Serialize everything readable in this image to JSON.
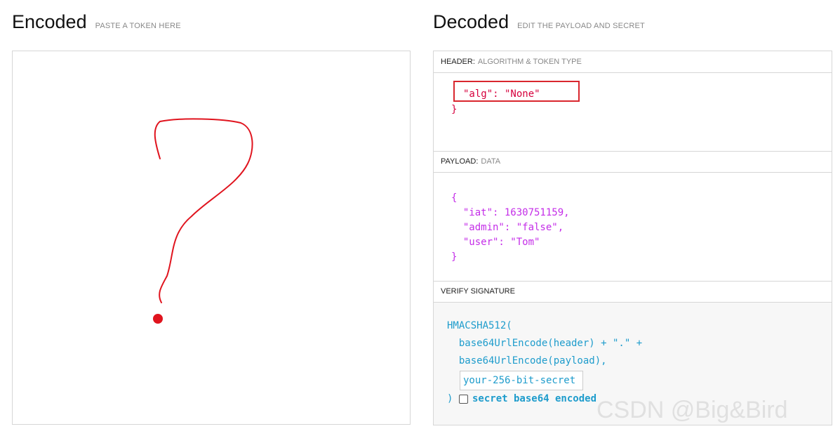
{
  "encoded": {
    "title": "Encoded",
    "subtitle": "PASTE A TOKEN HERE",
    "drawing": "hand-drawn-question-mark"
  },
  "decoded": {
    "title": "Decoded",
    "subtitle": "EDIT THE PAYLOAD AND SECRET",
    "header": {
      "label": "HEADER:",
      "sublabel": "ALGORITHM & TOKEN TYPE",
      "lines": [
        "\"alg\": \"None\"",
        "}"
      ]
    },
    "payload": {
      "label": "PAYLOAD:",
      "sublabel": "DATA",
      "lines": [
        "{",
        "  \"iat\": 1630751159,",
        "  \"admin\": \"false\",",
        "  \"user\": \"Tom\"",
        "}"
      ]
    },
    "verify": {
      "label": "VERIFY SIGNATURE",
      "lines": [
        "HMACSHA512(",
        "  base64UrlEncode(header) + \".\" +",
        "  base64UrlEncode(payload),"
      ],
      "secret_placeholder": "your-256-bit-secret",
      "close_paren": ")",
      "checkbox_label": "secret base64 encoded"
    }
  },
  "watermark": "CSDN @Big&Bird",
  "colors": {
    "header_json": "#d6003c",
    "payload_json": "#c42de8",
    "signature": "#1e9ccc",
    "annotation": "#d9262e"
  }
}
